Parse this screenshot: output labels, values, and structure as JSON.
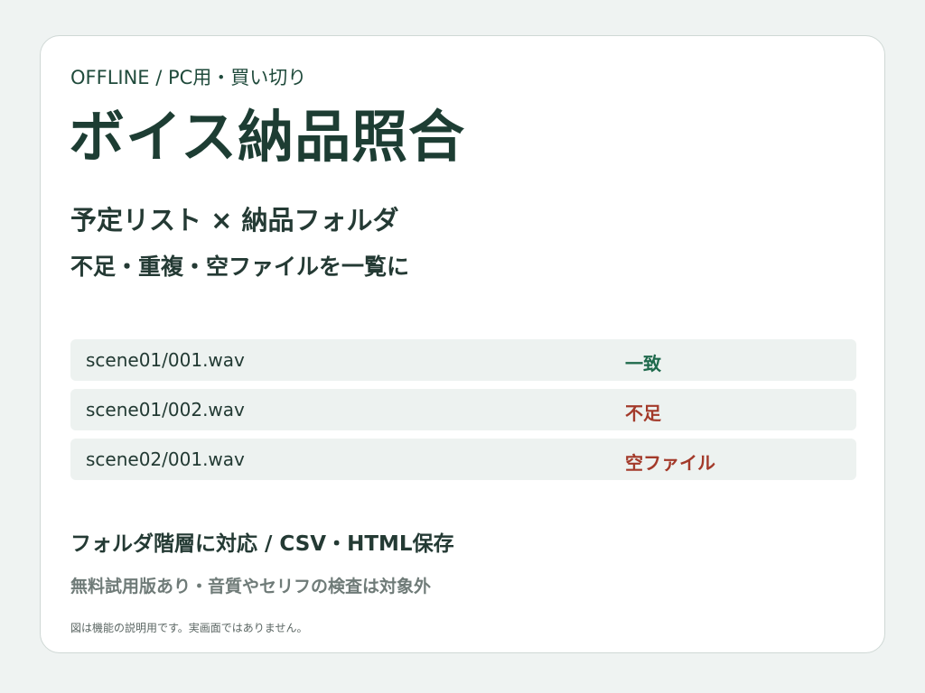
{
  "header": {
    "eyebrow": "OFFLINE / PC用・買い切り",
    "title": "ボイス納品照合",
    "subtitle": "予定リスト × 納品フォルダ",
    "subtitle2": "不足・重複・空ファイルを一覧に"
  },
  "rows": [
    {
      "file": "scene01/001.wav",
      "status": "一致",
      "status_color": "#1f6a4c"
    },
    {
      "file": "scene01/002.wav",
      "status": "不足",
      "status_color": "#a33a2a"
    },
    {
      "file": "scene02/001.wav",
      "status": "空ファイル",
      "status_color": "#a33a2a"
    }
  ],
  "footer": {
    "feature": "フォルダ階層に対応 / CSV・HTML保存",
    "note": "無料試用版あり・音質やセリフの検査は対象外",
    "disclaimer": "図は機能の説明用です。実画面ではありません。"
  }
}
